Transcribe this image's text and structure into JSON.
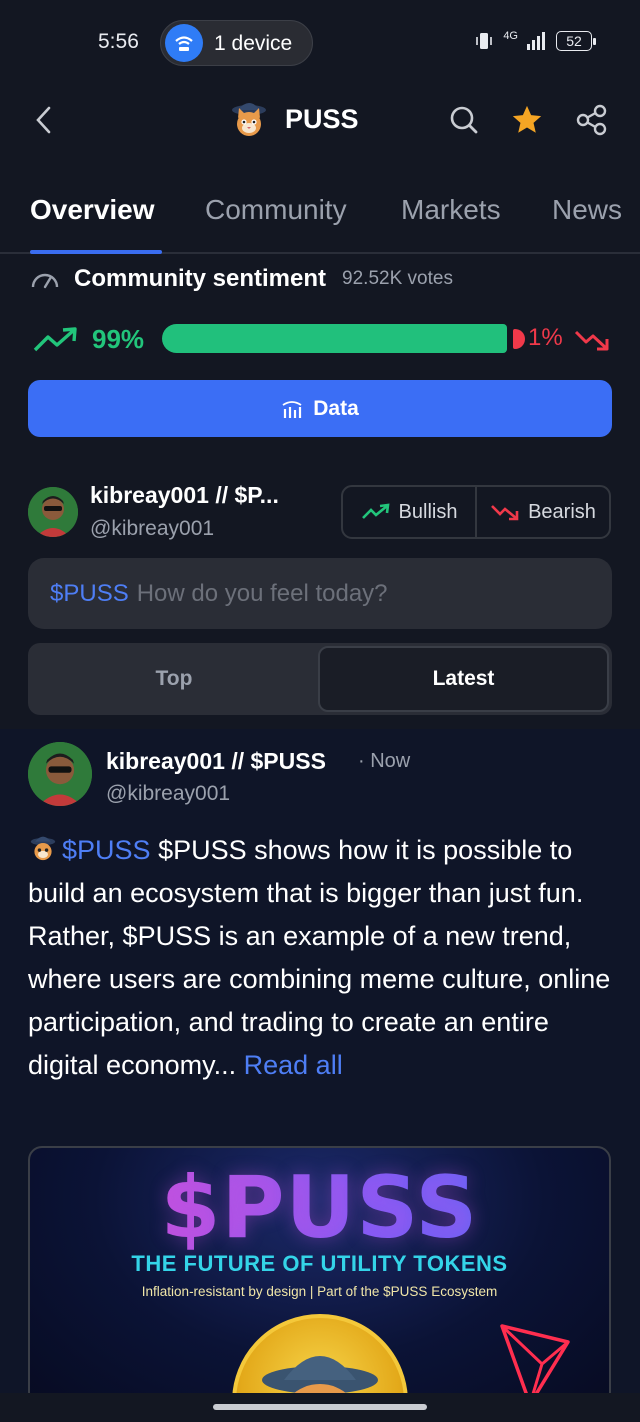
{
  "status_bar": {
    "time": "5:56",
    "device_pill": "1 device",
    "network": "4G",
    "battery": "52"
  },
  "header": {
    "title": "PUSS",
    "icons": [
      "back-chevron-icon",
      "search-icon",
      "star-icon",
      "share-icon"
    ],
    "star_color": "#f5a524"
  },
  "tabs": [
    {
      "label": "Overview",
      "active": true
    },
    {
      "label": "Community",
      "active": false
    },
    {
      "label": "Markets",
      "active": false
    },
    {
      "label": "News",
      "active": false
    }
  ],
  "sentiment": {
    "title": "Community sentiment",
    "votes": "92.52K votes",
    "bullish_pct": "99%",
    "bearish_pct": "1%",
    "bullish_fraction": 0.99,
    "bull_color": "#21c07c",
    "bear_color": "#f0394a"
  },
  "data_button": {
    "label": "Data"
  },
  "composer": {
    "name": "kibreay001 // $P...",
    "handle": "@kibreay001",
    "bullish_label": "Bullish",
    "bearish_label": "Bearish",
    "input_ticker": "$PUSS",
    "input_placeholder": "How do you feel today?"
  },
  "segment": {
    "options": [
      "Top",
      "Latest"
    ],
    "selected": "Latest"
  },
  "post": {
    "name": "kibreay001 // $PUSS",
    "time": "· Now",
    "handle": "@kibreay001",
    "ticker": "$PUSS",
    "body": "$PUSS shows how it is possible to build an ecosystem that is bigger than just fun. Rather, $PUSS is an example of a new trend, where users are combining meme culture, online participation, and trading to create an entire digital economy...",
    "read_all": "Read all",
    "image": {
      "title": "$PUSS",
      "subtitle": "THE FUTURE OF UTILITY TOKENS",
      "caption": "Inflation-resistant by design | Part of the $PUSS Ecosystem"
    }
  },
  "accent_color": "#3b6ef5"
}
